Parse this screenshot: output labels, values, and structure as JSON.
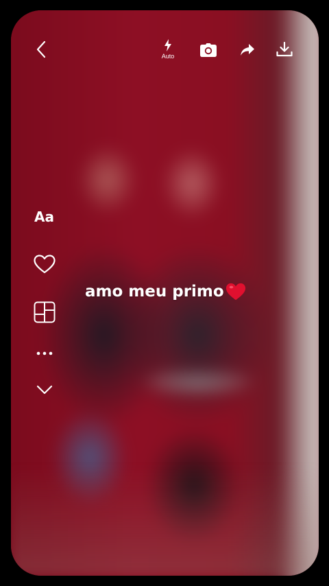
{
  "top_bar": {
    "back_icon": "chevron-left-icon",
    "flash": {
      "icon": "lightning-icon",
      "label": "Auto"
    },
    "camera_icon": "camera-icon",
    "share_icon": "share-arrow-icon",
    "download_icon": "download-icon"
  },
  "side_tools": {
    "text_tool_label": "Aa",
    "like_icon": "heart-outline-icon",
    "layout_icon": "layout-grid-icon",
    "more_icon": "more-dots-icon",
    "collapse_icon": "chevron-down-icon"
  },
  "caption": {
    "text": "amo meu primo",
    "emoji_icon": "red-heart-icon"
  },
  "colors": {
    "background": "#000000",
    "photo_tint": "#8a0d21",
    "icon": "#ffffff"
  }
}
